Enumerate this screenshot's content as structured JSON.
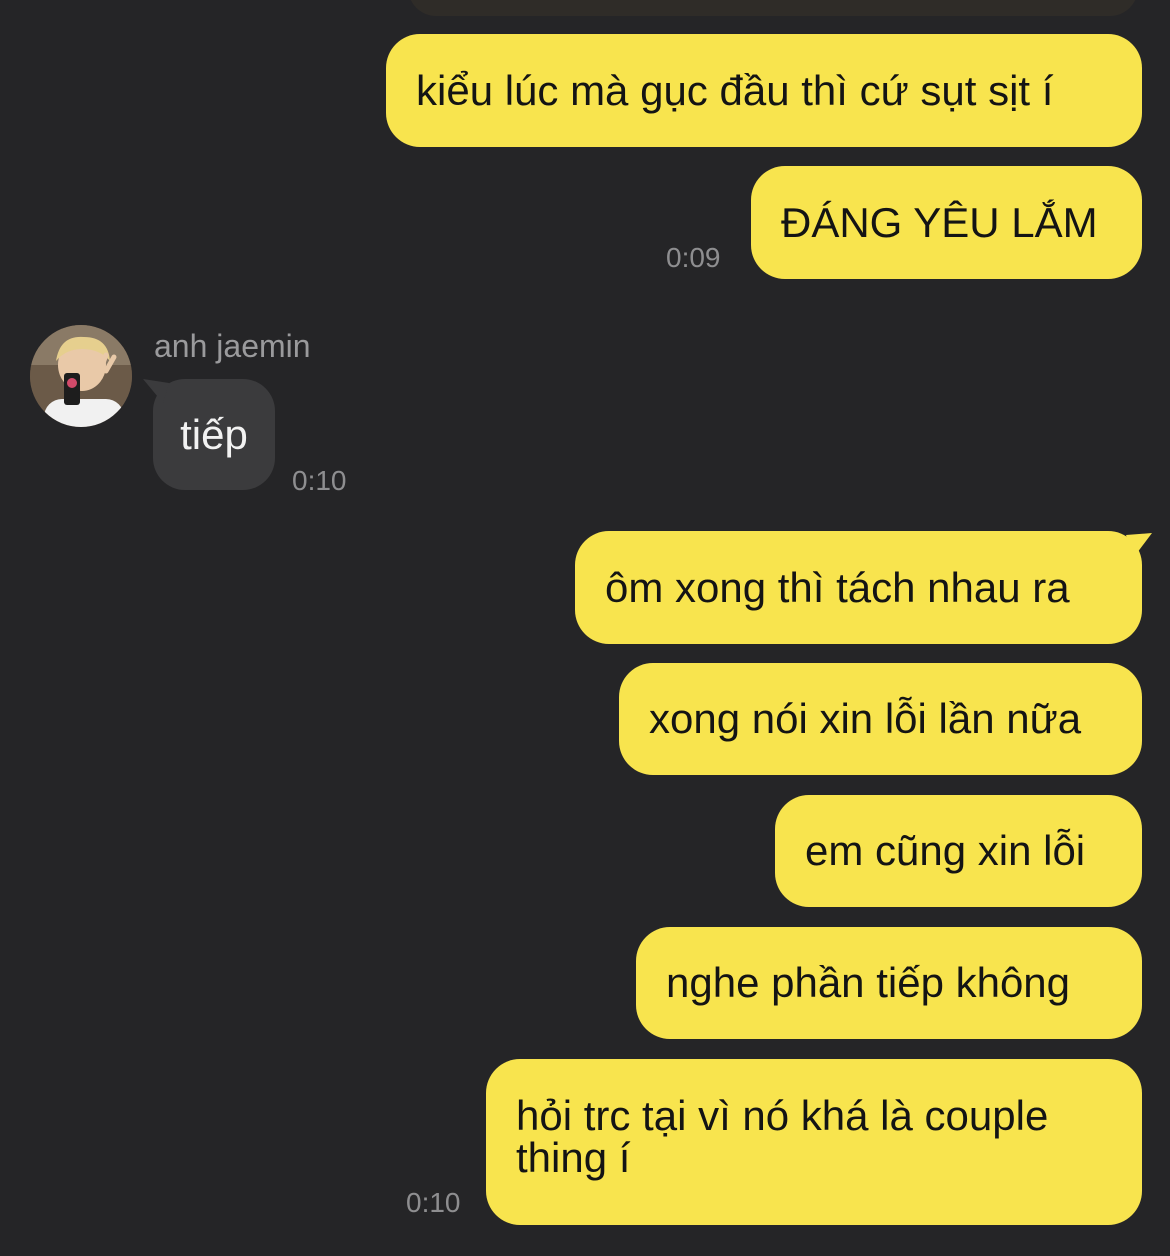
{
  "conversation": {
    "messages": [
      {
        "id": "m1",
        "from": "me",
        "text": "kiểu lúc mà gục đầu thì cứ sụt sịt í"
      },
      {
        "id": "m2",
        "from": "me",
        "text": "ĐÁNG YÊU LẮM",
        "time": "0:09"
      },
      {
        "id": "m3",
        "from": "anh jaemin",
        "sender_name": "anh jaemin",
        "text": "tiếp",
        "time": "0:10"
      },
      {
        "id": "m4",
        "from": "me",
        "text": "ôm xong thì tách nhau ra"
      },
      {
        "id": "m5",
        "from": "me",
        "text": "xong nói xin lỗi lần nữa"
      },
      {
        "id": "m6",
        "from": "me",
        "text": "em cũng xin lỗi"
      },
      {
        "id": "m7",
        "from": "me",
        "text": "nghe phần tiếp không"
      },
      {
        "id": "m8",
        "from": "me",
        "text": "hỏi trc tại vì nó khá là couple thing í",
        "time": "0:10"
      }
    ]
  },
  "colors": {
    "background": "#252527",
    "outgoing_bubble": "#f8e44e",
    "incoming_bubble": "#3b3b3d",
    "timestamp": "#8e8e90"
  },
  "icons": {
    "avatar": "profile-photo"
  }
}
